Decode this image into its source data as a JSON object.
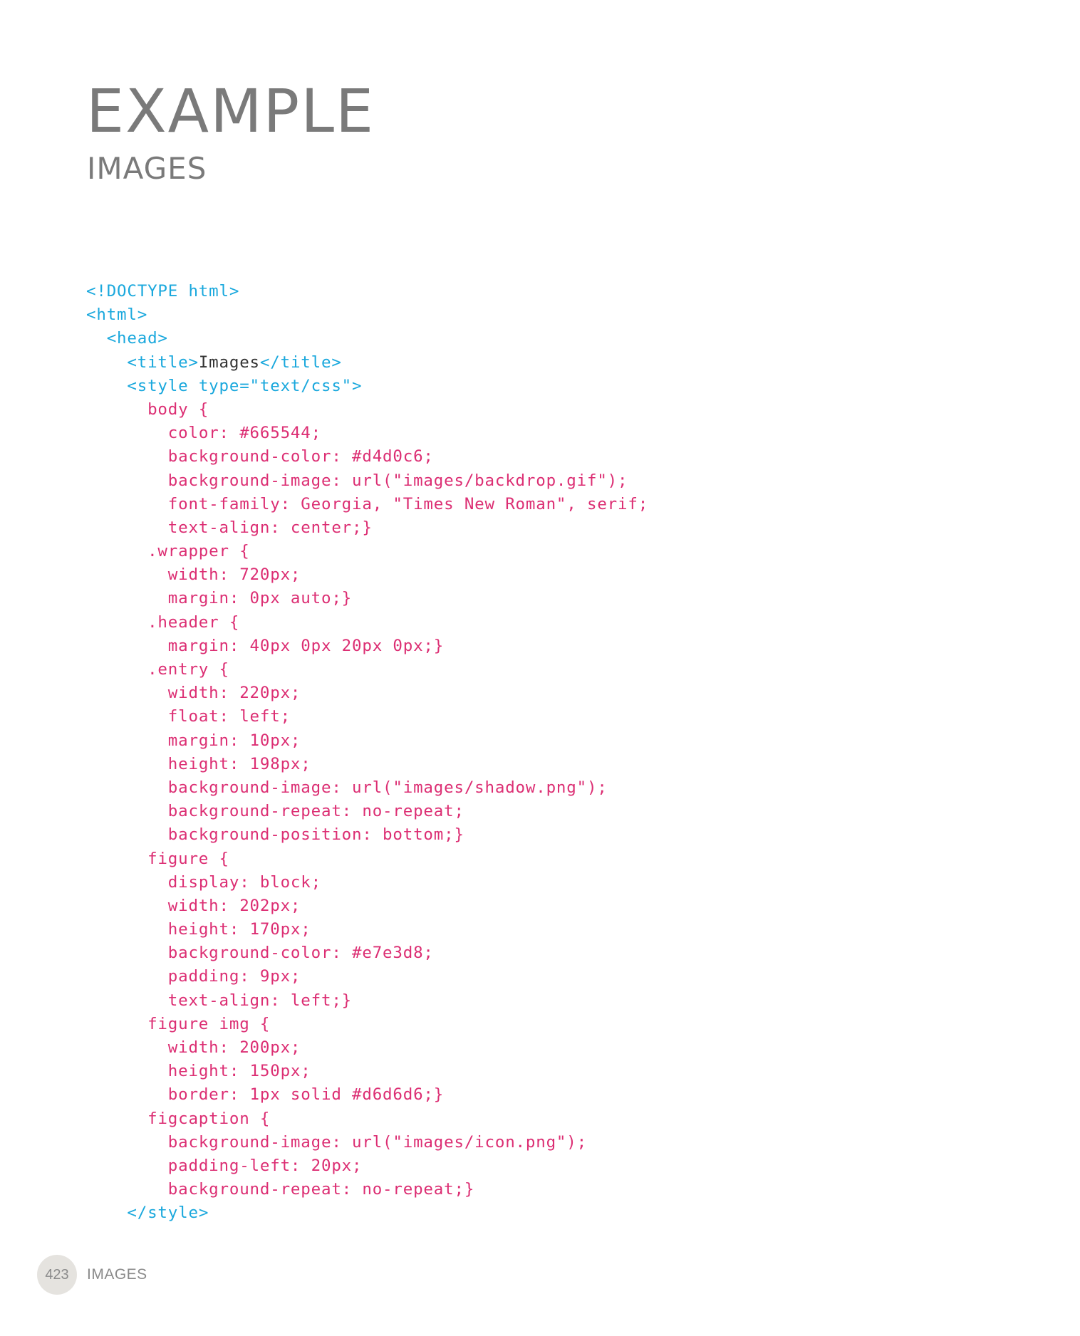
{
  "heading": {
    "title": "EXAMPLE",
    "subtitle": "IMAGES"
  },
  "colors": {
    "tag": "#1aa8dd",
    "css": "#dc2e73",
    "text": "#333333",
    "heading": "#7a7a7a"
  },
  "code": {
    "lines": [
      {
        "indent": 0,
        "tokens": [
          {
            "t": "tag",
            "v": "<!DOCTYPE html>"
          }
        ]
      },
      {
        "indent": 0,
        "tokens": [
          {
            "t": "tag",
            "v": "<html>"
          }
        ]
      },
      {
        "indent": 2,
        "tokens": [
          {
            "t": "tag",
            "v": "<head>"
          }
        ]
      },
      {
        "indent": 4,
        "tokens": [
          {
            "t": "tag",
            "v": "<title>"
          },
          {
            "t": "text",
            "v": "Images"
          },
          {
            "t": "tag",
            "v": "</title>"
          }
        ]
      },
      {
        "indent": 4,
        "tokens": [
          {
            "t": "tag",
            "v": "<style type=\"text/css\">"
          }
        ]
      },
      {
        "indent": 6,
        "tokens": [
          {
            "t": "css",
            "v": "body {"
          }
        ]
      },
      {
        "indent": 8,
        "tokens": [
          {
            "t": "css",
            "v": "color: #665544;"
          }
        ]
      },
      {
        "indent": 8,
        "tokens": [
          {
            "t": "css",
            "v": "background-color: #d4d0c6;"
          }
        ]
      },
      {
        "indent": 8,
        "tokens": [
          {
            "t": "css",
            "v": "background-image: url(\"images/backdrop.gif\");"
          }
        ]
      },
      {
        "indent": 8,
        "tokens": [
          {
            "t": "css",
            "v": "font-family: Georgia, \"Times New Roman\", serif;"
          }
        ]
      },
      {
        "indent": 8,
        "tokens": [
          {
            "t": "css",
            "v": "text-align: center;}"
          }
        ]
      },
      {
        "indent": 6,
        "tokens": [
          {
            "t": "css",
            "v": ".wrapper {"
          }
        ]
      },
      {
        "indent": 8,
        "tokens": [
          {
            "t": "css",
            "v": "width: 720px;"
          }
        ]
      },
      {
        "indent": 8,
        "tokens": [
          {
            "t": "css",
            "v": "margin: 0px auto;}"
          }
        ]
      },
      {
        "indent": 6,
        "tokens": [
          {
            "t": "css",
            "v": ".header {"
          }
        ]
      },
      {
        "indent": 8,
        "tokens": [
          {
            "t": "css",
            "v": "margin: 40px 0px 20px 0px;}"
          }
        ]
      },
      {
        "indent": 6,
        "tokens": [
          {
            "t": "css",
            "v": ".entry {"
          }
        ]
      },
      {
        "indent": 8,
        "tokens": [
          {
            "t": "css",
            "v": "width: 220px;"
          }
        ]
      },
      {
        "indent": 8,
        "tokens": [
          {
            "t": "css",
            "v": "float: left;"
          }
        ]
      },
      {
        "indent": 8,
        "tokens": [
          {
            "t": "css",
            "v": "margin: 10px;"
          }
        ]
      },
      {
        "indent": 8,
        "tokens": [
          {
            "t": "css",
            "v": "height: 198px;"
          }
        ]
      },
      {
        "indent": 8,
        "tokens": [
          {
            "t": "css",
            "v": "background-image: url(\"images/shadow.png\");"
          }
        ]
      },
      {
        "indent": 8,
        "tokens": [
          {
            "t": "css",
            "v": "background-repeat: no-repeat;"
          }
        ]
      },
      {
        "indent": 8,
        "tokens": [
          {
            "t": "css",
            "v": "background-position: bottom;}"
          }
        ]
      },
      {
        "indent": 6,
        "tokens": [
          {
            "t": "css",
            "v": "figure {"
          }
        ]
      },
      {
        "indent": 8,
        "tokens": [
          {
            "t": "css",
            "v": "display: block;"
          }
        ]
      },
      {
        "indent": 8,
        "tokens": [
          {
            "t": "css",
            "v": "width: 202px;"
          }
        ]
      },
      {
        "indent": 8,
        "tokens": [
          {
            "t": "css",
            "v": "height: 170px;"
          }
        ]
      },
      {
        "indent": 8,
        "tokens": [
          {
            "t": "css",
            "v": "background-color: #e7e3d8;"
          }
        ]
      },
      {
        "indent": 8,
        "tokens": [
          {
            "t": "css",
            "v": "padding: 9px;"
          }
        ]
      },
      {
        "indent": 8,
        "tokens": [
          {
            "t": "css",
            "v": "text-align: left;}"
          }
        ]
      },
      {
        "indent": 6,
        "tokens": [
          {
            "t": "css",
            "v": "figure img {"
          }
        ]
      },
      {
        "indent": 8,
        "tokens": [
          {
            "t": "css",
            "v": "width: 200px;"
          }
        ]
      },
      {
        "indent": 8,
        "tokens": [
          {
            "t": "css",
            "v": "height: 150px;"
          }
        ]
      },
      {
        "indent": 8,
        "tokens": [
          {
            "t": "css",
            "v": "border: 1px solid #d6d6d6;}"
          }
        ]
      },
      {
        "indent": 6,
        "tokens": [
          {
            "t": "css",
            "v": "figcaption {"
          }
        ]
      },
      {
        "indent": 8,
        "tokens": [
          {
            "t": "css",
            "v": "background-image: url(\"images/icon.png\");"
          }
        ]
      },
      {
        "indent": 8,
        "tokens": [
          {
            "t": "css",
            "v": "padding-left: 20px;"
          }
        ]
      },
      {
        "indent": 8,
        "tokens": [
          {
            "t": "css",
            "v": "background-repeat: no-repeat;}"
          }
        ]
      },
      {
        "indent": 4,
        "tokens": [
          {
            "t": "tag",
            "v": "</style>"
          }
        ]
      }
    ]
  },
  "footer": {
    "page_number": "423",
    "section": "IMAGES"
  }
}
